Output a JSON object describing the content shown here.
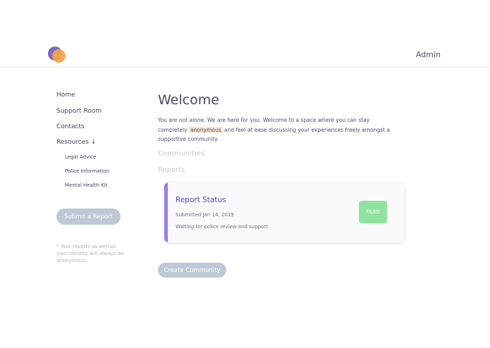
{
  "header": {
    "user_label": "Admin"
  },
  "sidebar": {
    "items": [
      {
        "label": "Home"
      },
      {
        "label": "Support Room"
      },
      {
        "label": "Contacts"
      },
      {
        "label": "Resources ↓"
      }
    ],
    "sub_items": [
      {
        "label": "Legal Advice"
      },
      {
        "label": "Police Information"
      },
      {
        "label": "Mental Health Kit"
      }
    ],
    "submit_label": "Submit a Report",
    "note": "* Your reports as well as your identity will always be anonymous."
  },
  "main": {
    "title": "Welcome",
    "intro_part1": "You are not alone. We are here for you. Welcome to a space where you can stay completely ",
    "intro_highlight": "anonymous",
    "intro_part2": " and feel at ease discussing your experiences freely amongst a supportive community.",
    "communities_label": "Communities",
    "reports_label": "Reports",
    "report": {
      "title": "Report Status",
      "submitted": "Submitted Jan 14, 2019",
      "status_text": "Waiting for police review and support",
      "badge": "FILED"
    },
    "create_label": "Create Community"
  },
  "colors": {
    "accent_purple": "#9b7de8",
    "badge_green": "#8fe39f",
    "button_gray": "#bfc8d6",
    "highlight": "#fbe3cf"
  }
}
